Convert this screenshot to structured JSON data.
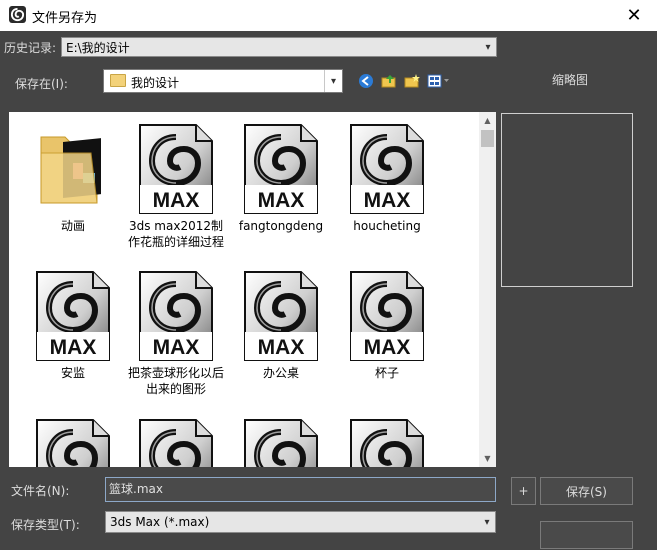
{
  "window": {
    "title": "文件另存为",
    "close_glyph": "✕"
  },
  "history": {
    "label": "历史记录:",
    "value": "E:\\我的设计"
  },
  "save_in": {
    "label": "保存在(I):",
    "value": "我的设计"
  },
  "toolbar": {
    "back_icon": "back-icon",
    "up_icon": "up-folder-icon",
    "new_folder_icon": "new-folder-icon",
    "view_menu_icon": "view-menu-icon"
  },
  "thumbnail": {
    "label": "缩略图"
  },
  "files": [
    {
      "name": "动画",
      "type": "folder"
    },
    {
      "name": "3ds max2012制作花瓶的详细过程",
      "type": "max"
    },
    {
      "name": "fangtongdeng",
      "type": "max"
    },
    {
      "name": "houcheting",
      "type": "max"
    },
    {
      "name": "安监",
      "type": "max"
    },
    {
      "name": "把茶壶球形化以后出来的图形",
      "type": "max"
    },
    {
      "name": "办公桌",
      "type": "max"
    },
    {
      "name": "杯子",
      "type": "max"
    },
    {
      "name": "",
      "type": "max"
    },
    {
      "name": "",
      "type": "max"
    },
    {
      "name": "",
      "type": "max"
    },
    {
      "name": "",
      "type": "max"
    }
  ],
  "max_badge": "MAX",
  "filename": {
    "label": "文件名(N):",
    "value": "篮球.max"
  },
  "filetype": {
    "label": "保存类型(T):",
    "value": "3ds Max (*.max)"
  },
  "buttons": {
    "increment": "+",
    "save": "保存(S)"
  },
  "colors": {
    "dialog_bg": "#444444",
    "list_bg": "#ffffff",
    "title_bg": "#ffffff"
  }
}
